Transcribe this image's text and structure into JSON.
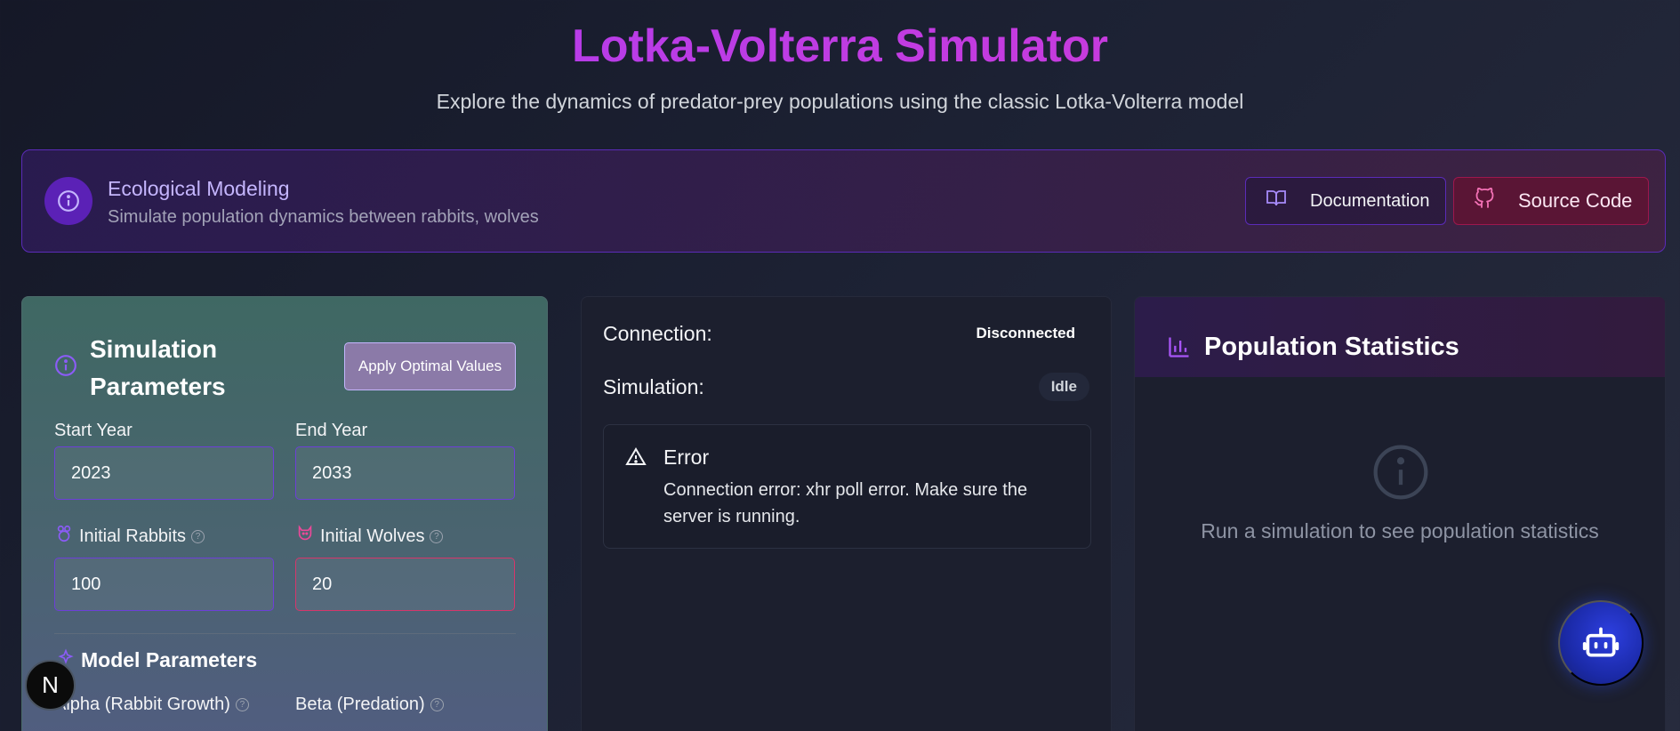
{
  "header": {
    "title": "Lotka-Volterra Simulator",
    "subtitle": "Explore the dynamics of predator-prey populations using the classic Lotka-Volterra model"
  },
  "banner": {
    "title": "Ecological Modeling",
    "description": "Simulate population dynamics between rabbits, wolves",
    "documentation_label": "Documentation",
    "source_label": "Source Code"
  },
  "params": {
    "title": "Simulation Parameters",
    "apply_optimal_label": "Apply Optimal Values",
    "start_year_label": "Start Year",
    "start_year_value": "2023",
    "end_year_label": "End Year",
    "end_year_value": "2033",
    "initial_rabbits_label": "Initial Rabbits",
    "initial_rabbits_value": "100",
    "initial_wolves_label": "Initial Wolves",
    "initial_wolves_value": "20",
    "model_section_title": "Model Parameters",
    "alpha_label": "Alpha (Rabbit Growth)",
    "beta_label": "Beta (Predation)",
    "help_glyph": "?"
  },
  "status": {
    "connection_label": "Connection:",
    "connection_value": "Disconnected",
    "simulation_label": "Simulation:",
    "simulation_value": "Idle",
    "error_title": "Error",
    "error_message": "Connection error: xhr poll error. Make sure the server is running."
  },
  "stats": {
    "title": "Population Statistics",
    "empty_message": "Run a simulation to see population statistics"
  },
  "badge": {
    "letter": "N"
  },
  "colors": {
    "accent_purple": "#a83df2",
    "accent_pink": "#d63ad3",
    "border_purple": "#6d3fd8",
    "border_pink": "#d6366b"
  }
}
